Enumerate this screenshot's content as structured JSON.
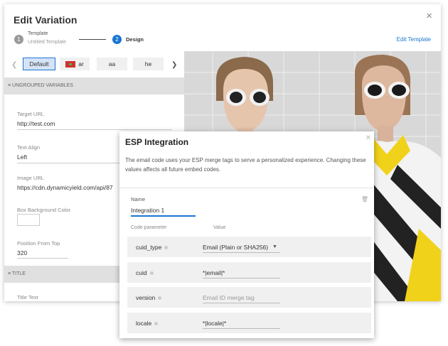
{
  "dialog": {
    "title": "Edit Variation",
    "close": "×",
    "steps": [
      {
        "number": "1",
        "label": "Template",
        "sublabel": "Untitled Template"
      },
      {
        "number": "2",
        "label": "Design"
      }
    ],
    "edit_template": "Edit Template"
  },
  "tabs": [
    {
      "label": "Default",
      "active": true
    },
    {
      "label": "ar",
      "flag": "morocco"
    },
    {
      "label": "aa"
    },
    {
      "label": "he"
    }
  ],
  "sections": {
    "ungrouped": "≡ UNGROUPED VARIABLES",
    "title": "≡ TITLE"
  },
  "fields": {
    "target_url": {
      "label": "Target URL",
      "value": "http://test.com"
    },
    "text_align": {
      "label": "Text Align",
      "value": "Left"
    },
    "image_url": {
      "label": "Image URL",
      "value": "https://cdn.dynamicyield.com/api/87"
    },
    "box_bg": {
      "label": "Box Background Color"
    },
    "position_top": {
      "label": "Position From Top",
      "value": "320"
    },
    "title_text": {
      "label": "Title Text"
    }
  },
  "esp": {
    "title": "ESP Integration",
    "description": "The email code uses your ESP merge tags to serve a personalized experience. Changing these values affects all future embed codes.",
    "name_label": "Name",
    "name_value": "Integration 1",
    "col_param": "Code parameter",
    "col_value": "Value",
    "params": [
      {
        "name": "cuid_type",
        "value": "Email (Plain or SHA256)",
        "dropdown": true
      },
      {
        "name": "cuid",
        "value": "*|email|*"
      },
      {
        "name": "version",
        "placeholder": "Email ID merge tag"
      },
      {
        "name": "locale",
        "value": "*|locale|*"
      }
    ]
  },
  "colors": {
    "accent": "#1976d2",
    "section_bg": "#e0e0e0",
    "row_bg": "#f0f0f0"
  }
}
